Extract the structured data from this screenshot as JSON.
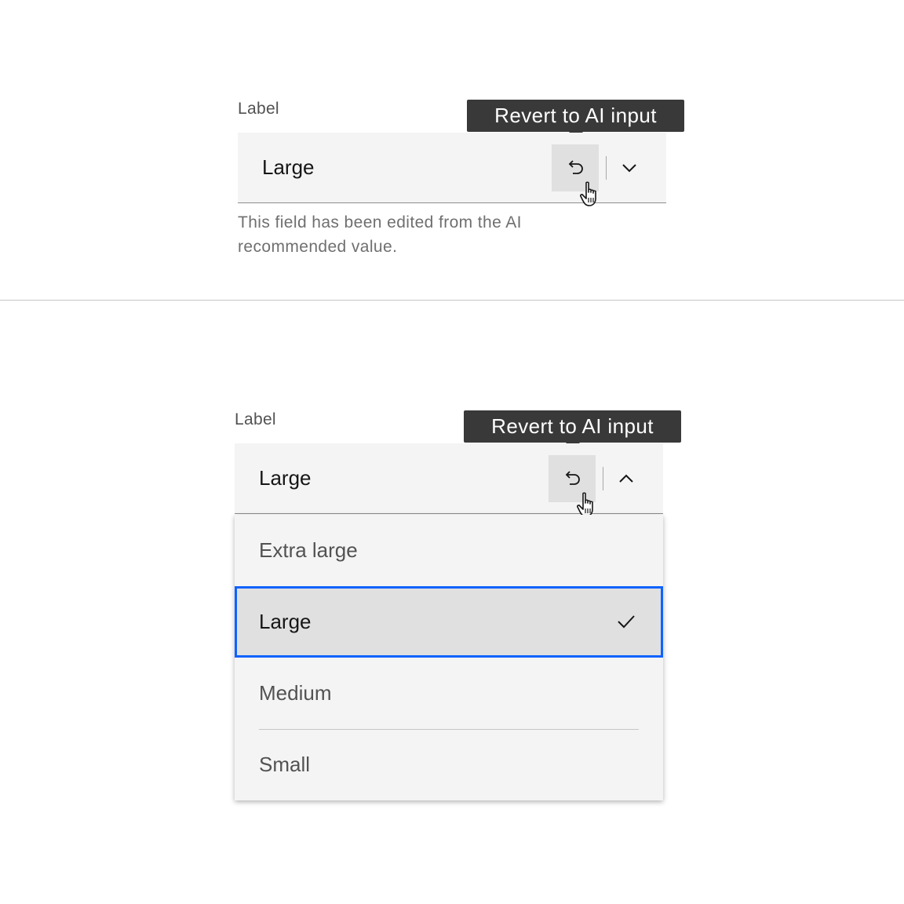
{
  "colors": {
    "field_background": "#f4f4f4",
    "tooltip_background": "#393939",
    "hover_background": "#e0e0e0",
    "focus_border": "#0f62fe",
    "helper_text": "#6f6f6f"
  },
  "example_closed": {
    "label": "Label",
    "tooltip": "Revert to AI input",
    "value": "Large",
    "revert_icon": "undo-icon",
    "toggle_icon": "chevron-down-icon",
    "helper_text": "This field has been edited from the AI recommended value."
  },
  "example_open": {
    "label": "Label",
    "tooltip": "Revert to AI input",
    "value": "Large",
    "revert_icon": "undo-icon",
    "toggle_icon": "chevron-up-icon",
    "options": [
      {
        "label": "Extra large",
        "selected": false
      },
      {
        "label": "Large",
        "selected": true
      },
      {
        "label": "Medium",
        "selected": false
      },
      {
        "label": "Small",
        "selected": false
      }
    ],
    "selected_icon": "checkmark-icon"
  }
}
